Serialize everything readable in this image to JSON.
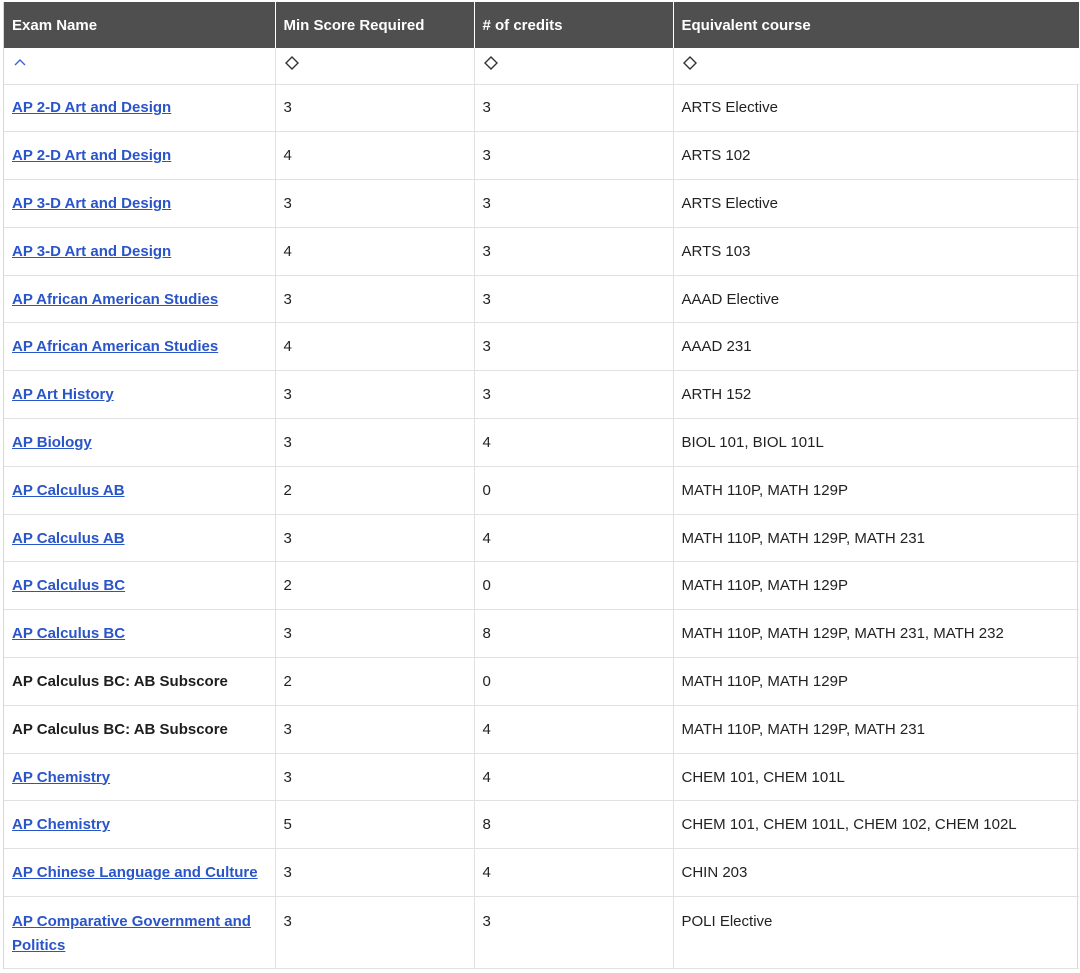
{
  "table": {
    "headers": {
      "exam_name": "Exam Name",
      "min_score": "Min Score Required",
      "credits": "# of credits",
      "equivalent": "Equivalent course"
    },
    "colors": {
      "header_bg": "#4f4f4f",
      "link": "#2a55c9",
      "sort_active": "#3a64d8"
    },
    "sort_icons": {
      "exam_name": "chevron-up-icon",
      "min_score": "sort-diamond-icon",
      "credits": "sort-diamond-icon",
      "equivalent": "sort-diamond-icon"
    },
    "rows": [
      {
        "exam": "AP 2-D Art and Design",
        "link": true,
        "score": "3",
        "credits": "3",
        "course": "ARTS Elective"
      },
      {
        "exam": "AP 2-D Art and Design",
        "link": true,
        "score": "4",
        "credits": "3",
        "course": "ARTS 102"
      },
      {
        "exam": "AP 3-D Art and Design",
        "link": true,
        "score": "3",
        "credits": "3",
        "course": "ARTS Elective"
      },
      {
        "exam": "AP 3-D Art and Design",
        "link": true,
        "score": "4",
        "credits": "3",
        "course": "ARTS 103"
      },
      {
        "exam": "AP African American Studies",
        "link": true,
        "score": "3",
        "credits": "3",
        "course": "AAAD Elective"
      },
      {
        "exam": "AP African American Studies",
        "link": true,
        "score": "4",
        "credits": "3",
        "course": "AAAD 231"
      },
      {
        "exam": "AP Art History",
        "link": true,
        "score": "3",
        "credits": "3",
        "course": "ARTH 152"
      },
      {
        "exam": "AP Biology",
        "link": true,
        "score": "3",
        "credits": "4",
        "course": "BIOL 101, BIOL 101L"
      },
      {
        "exam": "AP Calculus AB",
        "link": true,
        "score": "2",
        "credits": "0",
        "course": "MATH 110P, MATH 129P"
      },
      {
        "exam": "AP Calculus AB",
        "link": true,
        "score": "3",
        "credits": "4",
        "course": "MATH 110P, MATH 129P, MATH 231"
      },
      {
        "exam": "AP Calculus BC",
        "link": true,
        "score": "2",
        "credits": "0",
        "course": "MATH 110P, MATH 129P"
      },
      {
        "exam": "AP Calculus BC",
        "link": true,
        "score": "3",
        "credits": "8",
        "course": "MATH 110P, MATH 129P, MATH 231, MATH 232"
      },
      {
        "exam": "AP Calculus BC: AB Subscore",
        "link": false,
        "score": "2",
        "credits": "0",
        "course": "MATH 110P, MATH 129P"
      },
      {
        "exam": "AP Calculus BC: AB Subscore",
        "link": false,
        "score": "3",
        "credits": "4",
        "course": "MATH 110P, MATH 129P, MATH 231"
      },
      {
        "exam": "AP Chemistry",
        "link": true,
        "score": "3",
        "credits": "4",
        "course": "CHEM 101, CHEM 101L"
      },
      {
        "exam": "AP Chemistry",
        "link": true,
        "score": "5",
        "credits": "8",
        "course": "CHEM 101, CHEM 101L, CHEM 102, CHEM 102L"
      },
      {
        "exam": "AP Chinese Language and Culture",
        "link": true,
        "score": "3",
        "credits": "4",
        "course": "CHIN 203"
      },
      {
        "exam": "AP Comparative Government and Politics",
        "link": true,
        "score": "3",
        "credits": "3",
        "course": "POLI Elective"
      }
    ]
  }
}
